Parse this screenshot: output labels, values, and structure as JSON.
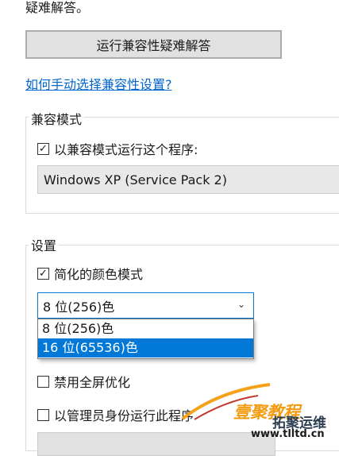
{
  "intro_text": "疑难解答。",
  "troubleshoot_button": "运行兼容性疑难解答",
  "manual_link": "如何手动选择兼容性设置?",
  "compat_group": {
    "label": "兼容模式",
    "checkbox_label": "以兼容模式运行这个程序:",
    "checked": true,
    "os_select": "Windows XP (Service Pack 2)"
  },
  "settings_group": {
    "label": "设置",
    "reduced_color": {
      "label": "简化的颜色模式",
      "checked": true
    },
    "color_select": {
      "value": "8 位(256)色",
      "options": [
        "8 位(256)色",
        "16 位(65536)色"
      ],
      "highlighted_index": 1
    },
    "fullscreen_opt": {
      "label": "禁用全屏优化",
      "checked": false
    },
    "run_as_admin": {
      "label": "以管理员身份运行此程序",
      "checked": false
    }
  },
  "check_mark": "✓",
  "chevron": "⌄",
  "watermark": {
    "line1": "壹聚教程",
    "line2": "拓聚运维",
    "url": "www.tlltd.cn"
  }
}
